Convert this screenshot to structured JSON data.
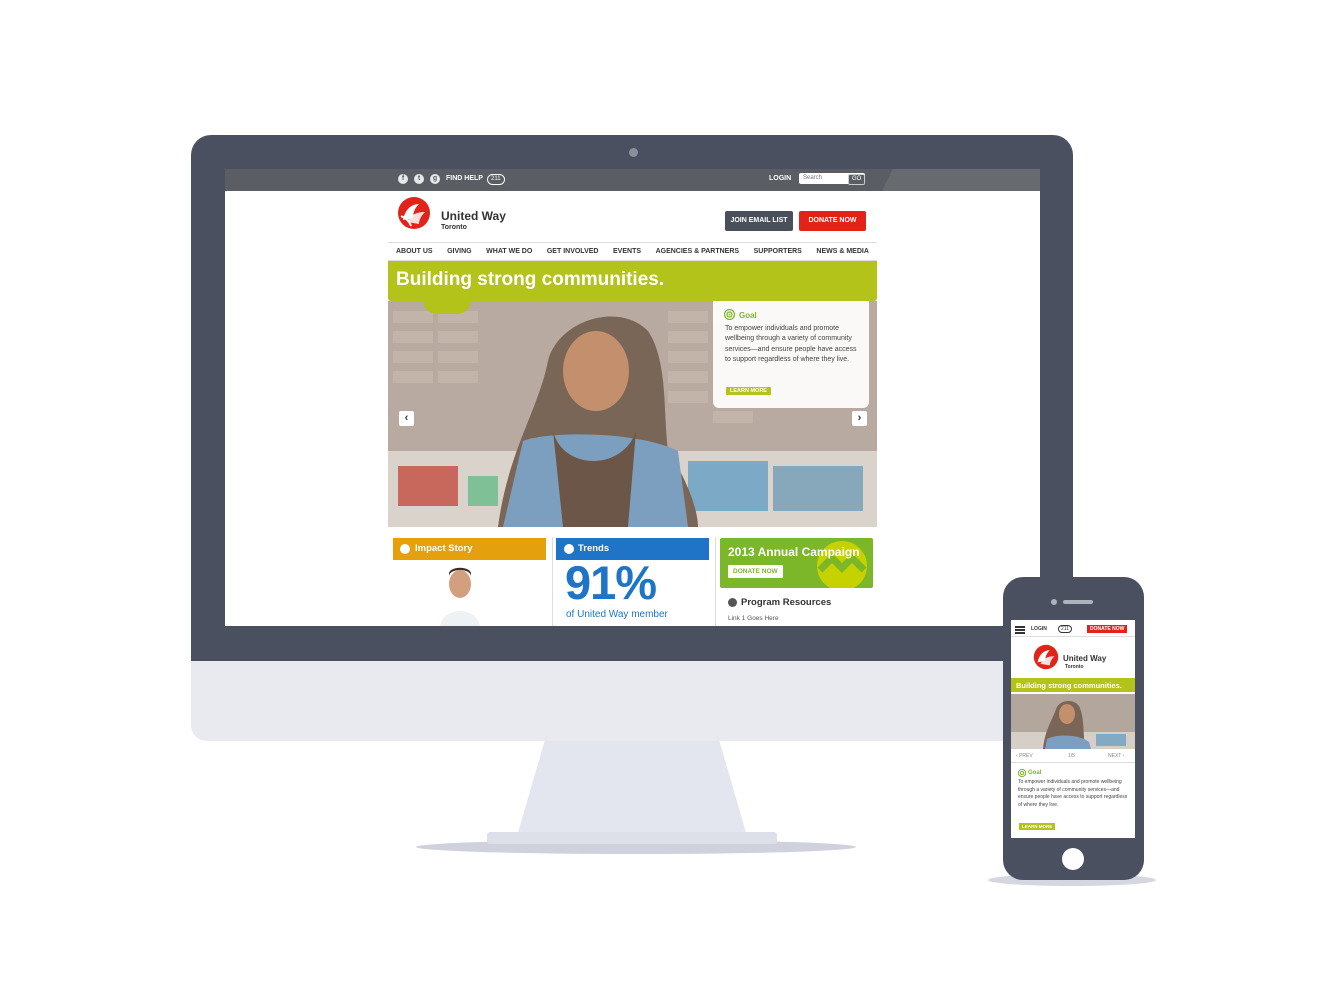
{
  "colors": {
    "accent_green": "#b3c31a",
    "donate_red": "#e2231a",
    "device_gray": "#4a505f",
    "impact_orange": "#e5a00d",
    "trends_blue": "#1f74c7",
    "campaign_green": "#7bb728"
  },
  "topbar": {
    "social": [
      {
        "icon": "facebook-icon",
        "glyph": "f"
      },
      {
        "icon": "twitter-icon",
        "glyph": "t"
      },
      {
        "icon": "googleplus-icon",
        "glyph": "g"
      }
    ],
    "find_help": "FIND HELP",
    "help_badge": "211",
    "login": "LOGIN",
    "search_placeholder": "Search",
    "go": "GO"
  },
  "header": {
    "logo_name": "United Way",
    "logo_city": "Toronto",
    "join_email": "JOIN EMAIL LIST",
    "donate": "DONATE NOW"
  },
  "nav": [
    "ABOUT US",
    "GIVING",
    "WHAT WE DO",
    "GET INVOLVED",
    "EVENTS",
    "AGENCIES & PARTNERS",
    "SUPPORTERS",
    "NEWS & MEDIA"
  ],
  "hero": {
    "title": "Building strong communities.",
    "goal_label": "Goal",
    "goal_text": "To empower individuals and promote wellbeing through a variety of community services—and ensure people have access to support regardless of where they live.",
    "learn_more": "LEARN MORE",
    "prev_arrow": "‹",
    "next_arrow": "›"
  },
  "cards": {
    "impact": "Impact Story",
    "trends": "Trends",
    "trends_stat": "91%",
    "trends_caption": "of United Way member",
    "campaign_title": "2013 Annual Campaign",
    "campaign_donate": "DONATE NOW",
    "resources_title": "Program Resources",
    "resources_link": "Link 1 Goes Here"
  },
  "mobile": {
    "login": "LOGIN",
    "help_badge": "211",
    "donate": "DONATE NOW",
    "logo_name": "United Way",
    "logo_city": "Toronto",
    "hero_title": "Building strong communities.",
    "prev": "PREV",
    "pager": "1/5",
    "next": "NEXT",
    "goal_label": "Goal",
    "goal_text": "To empower individuals and promote wellbeing through a variety of community services—and ensure people have access to support regardless of where they live.",
    "learn_more": "LEARN MORE"
  }
}
